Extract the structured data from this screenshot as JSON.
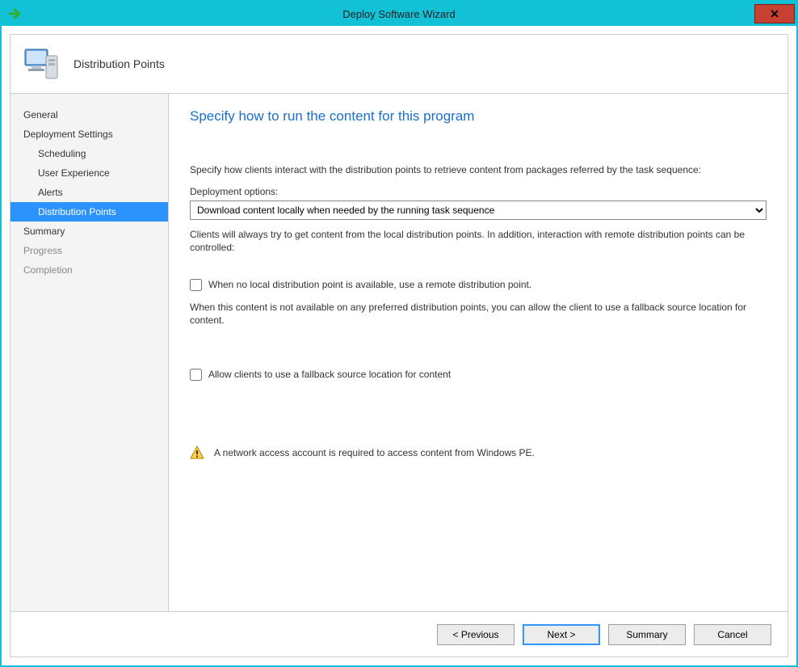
{
  "window": {
    "title": "Deploy Software Wizard"
  },
  "header": {
    "title": "Distribution Points"
  },
  "sidebar": {
    "items": [
      {
        "label": "General",
        "sub": false,
        "selected": false,
        "disabled": false
      },
      {
        "label": "Deployment Settings",
        "sub": false,
        "selected": false,
        "disabled": false
      },
      {
        "label": "Scheduling",
        "sub": true,
        "selected": false,
        "disabled": false
      },
      {
        "label": "User Experience",
        "sub": true,
        "selected": false,
        "disabled": false
      },
      {
        "label": "Alerts",
        "sub": true,
        "selected": false,
        "disabled": false
      },
      {
        "label": "Distribution Points",
        "sub": true,
        "selected": true,
        "disabled": false
      },
      {
        "label": "Summary",
        "sub": false,
        "selected": false,
        "disabled": false
      },
      {
        "label": "Progress",
        "sub": false,
        "selected": false,
        "disabled": true
      },
      {
        "label": "Completion",
        "sub": false,
        "selected": false,
        "disabled": true
      }
    ]
  },
  "content": {
    "heading": "Specify how to run the content for this program",
    "intro": "Specify how clients interact with the distribution points to retrieve content from packages referred by the task sequence:",
    "deploy_label": "Deployment options:",
    "deploy_value": "Download content locally when needed by the running task sequence",
    "clients_note": "Clients will always try to get content from the local distribution points. In addition, interaction with remote distribution points can be controlled:",
    "chk_remote": "When no local distribution point is available, use a remote distribution point.",
    "fallback_note": "When this content is not available on any preferred distribution points, you can allow the client to use a fallback source location for content.",
    "chk_fallback": "Allow clients to use a fallback source location for content",
    "warn": "A network access account is required to access content from Windows PE."
  },
  "footer": {
    "previous": "< Previous",
    "next": "Next >",
    "summary": "Summary",
    "cancel": "Cancel"
  }
}
